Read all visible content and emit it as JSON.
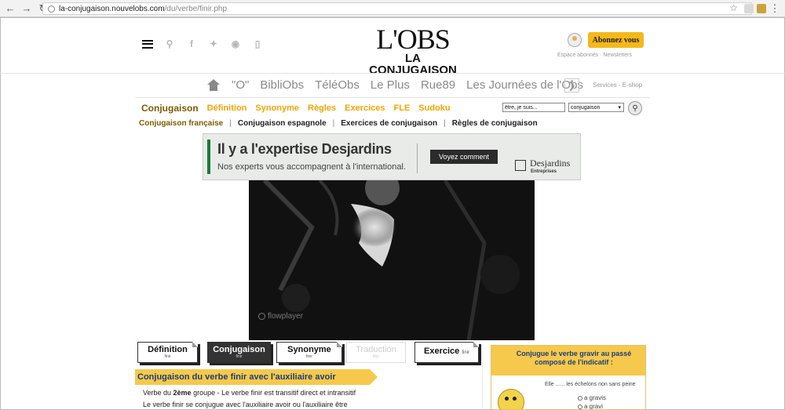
{
  "browser": {
    "url_host": "la-conjugaison.nouvelobs.com",
    "url_path": "/du/verbe/finir.php"
  },
  "header": {
    "logo_line1": "L'OBS",
    "logo_line2": "LA CONJUGAISON",
    "subscribe_label": "Abonnez vous",
    "account_links": "Espace abonnés · Newsletters"
  },
  "main_nav": {
    "items": [
      "\"O\"",
      "BibliObs",
      "TéléObs",
      "Le Plus",
      "Rue89",
      "Les Journées de l'Obs"
    ],
    "services": "Services · E-shop"
  },
  "sub_nav": {
    "active": "Conjugaison",
    "items": [
      "Définition",
      "Synonyme",
      "Règles",
      "Exercices",
      "FLE",
      "Sudoku"
    ]
  },
  "search": {
    "value": "être, je suis...",
    "select_value": "conjugaison"
  },
  "conj_nav": {
    "items": [
      "Conjugaison française",
      "Conjugaison espagnole",
      "Exercices de conjugaison",
      "Règles de conjugaison"
    ]
  },
  "ad": {
    "headline": "Il y a l'expertise Desjardins",
    "sub": "Nos experts vous accompagnent à l'international.",
    "cta": "Voyez comment",
    "brand": "Desjardins",
    "brand_sub": "Entreprises"
  },
  "video": {
    "watermark": "flowplayer"
  },
  "tabs": [
    {
      "title": "Définition",
      "sub": "finir"
    },
    {
      "title": "Conjugaison",
      "sub": "finir"
    },
    {
      "title": "Synonyme",
      "sub": "finir"
    },
    {
      "title": "Traduction",
      "sub": "finir"
    },
    {
      "title": "Exercice",
      "sub": "finir"
    }
  ],
  "content": {
    "section_title": "Conjugaison du verbe finir avec l'auxiliaire avoir",
    "line1_prefix": "Verbe du ",
    "line1_bold": "2ème",
    "line1_suffix": " groupe - Le verbe finir est transitif direct et intransitif",
    "line2": "Le verbe finir se conjugue avec l'auxiliaire avoir ou l'auxiliaire être"
  },
  "widget": {
    "question": "Conjugue le verbe gravir au passé composé de l'indicatif :",
    "sentence": "Elle ...... les échelons non sans peine",
    "options": [
      "a gravis",
      "a gravi"
    ]
  }
}
